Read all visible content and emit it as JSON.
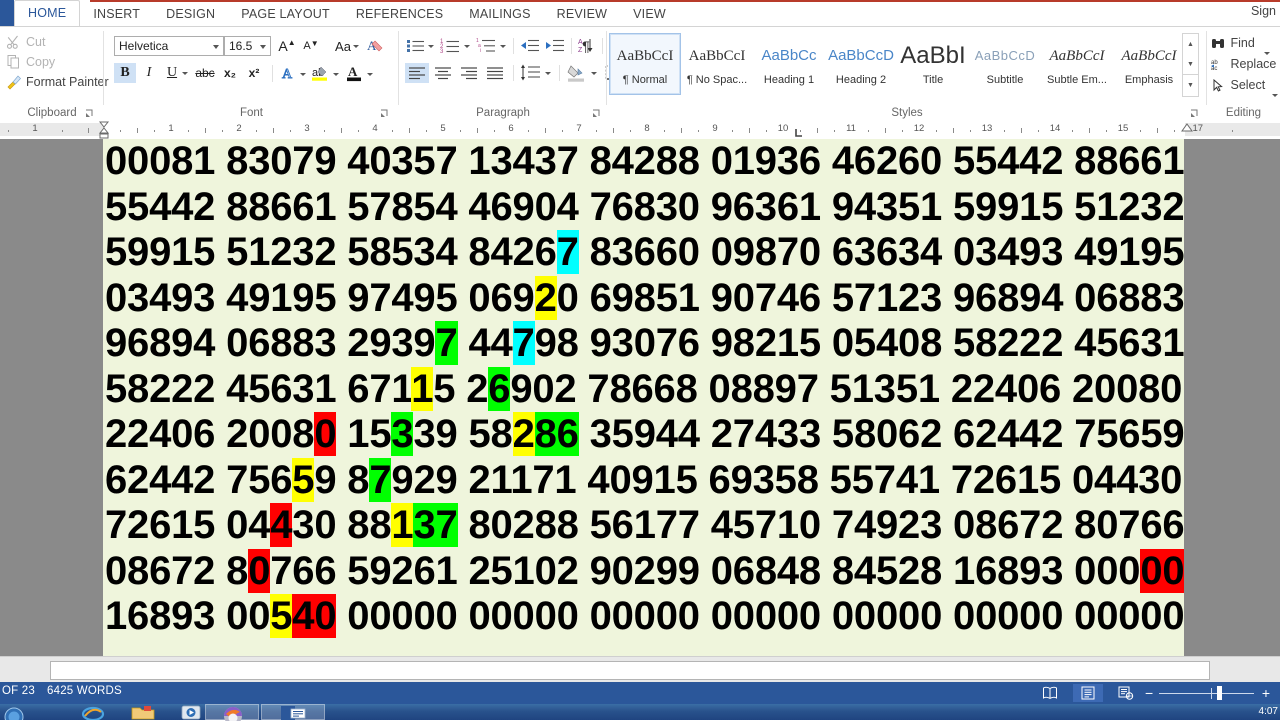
{
  "window": {
    "sign_in": "Sign",
    "accent": "#2b579a"
  },
  "ribbon": {
    "tabs": [
      {
        "label": "HOME",
        "active": true
      },
      {
        "label": "INSERT",
        "active": false
      },
      {
        "label": "DESIGN",
        "active": false
      },
      {
        "label": "PAGE LAYOUT",
        "active": false
      },
      {
        "label": "REFERENCES",
        "active": false
      },
      {
        "label": "MAILINGS",
        "active": false
      },
      {
        "label": "REVIEW",
        "active": false
      },
      {
        "label": "VIEW",
        "active": false
      }
    ],
    "clipboard": {
      "group_label": "Clipboard",
      "cut": "Cut",
      "copy": "Copy",
      "format_painter": "Format Painter"
    },
    "font": {
      "group_label": "Font",
      "font_name": "Helvetica",
      "font_size": "16.5",
      "bold": "B",
      "italic": "I",
      "underline": "U",
      "strikethrough": "abc",
      "subscript": "x₂",
      "superscript": "x²",
      "grow_font": "A",
      "shrink_font": "A",
      "change_case": "Aa",
      "clear_formatting": "clear-formatting-icon",
      "text_effects": "A",
      "highlight": "ab",
      "font_color": "A"
    },
    "paragraph": {
      "group_label": "Paragraph"
    },
    "styles": {
      "group_label": "Styles",
      "items": [
        {
          "preview": "AaBbCcI",
          "name": "¶ Normal",
          "selected": true,
          "style": "serif-normal"
        },
        {
          "preview": "AaBbCcI",
          "name": "¶ No Spac...",
          "selected": false,
          "style": "serif-normal"
        },
        {
          "preview": "AaBbCc",
          "name": "Heading 1",
          "selected": false,
          "style": "blue-heading"
        },
        {
          "preview": "AaBbCcD",
          "name": "Heading 2",
          "selected": false,
          "style": "blue-heading"
        },
        {
          "preview": "AaBbI",
          "name": "Title",
          "selected": false,
          "style": "title"
        },
        {
          "preview": "AaBbCcD",
          "name": "Subtitle",
          "selected": false,
          "style": "subtitle"
        },
        {
          "preview": "AaBbCcI",
          "name": "Subtle Em...",
          "selected": false,
          "style": "italic"
        },
        {
          "preview": "AaBbCcI",
          "name": "Emphasis",
          "selected": false,
          "style": "italic"
        }
      ]
    },
    "editing": {
      "group_label": "Editing",
      "find": "Find",
      "replace": "Replace",
      "select": "Select"
    }
  },
  "ruler": {
    "left_numbers": [
      "1"
    ],
    "numbers": [
      "1",
      "2",
      "3",
      "4",
      "5",
      "6",
      "7",
      "8",
      "9",
      "10",
      "11",
      "12",
      "13",
      "14",
      "15",
      "17"
    ]
  },
  "document": {
    "page_background": "#eff5dc",
    "font_family": "Helvetica",
    "highlight_colors": {
      "yellow": "#ffff00",
      "green": "#00ff00",
      "cyan": "#00ffff",
      "red": "#ff0000"
    },
    "lines": [
      {
        "text": "00081 83079 40357 13437 84288 01936 46260 55442 88661",
        "runs": [
          {
            "t": "00081 83079 40357 13437 84288 01936 46260 55442 88661",
            "h": null
          }
        ]
      },
      {
        "text": "55442 88661 57854 46904 76830 96361 94351 59915 51232",
        "runs": [
          {
            "t": "55442 88661 57854 46904 76830 96361 94351 59915 51232",
            "h": null
          }
        ]
      },
      {
        "text": "59915 51232 58534 84267 83660 09870 63634 03493 49195",
        "runs": [
          {
            "t": "59915 51232 58534 8426",
            "h": null
          },
          {
            "t": "7",
            "h": "cyan"
          },
          {
            "t": " 83660 09870 63634 03493 49195",
            "h": null
          }
        ]
      },
      {
        "text": "03493 49195 97495 06920 69851 90746 57123 96894 06883",
        "runs": [
          {
            "t": "03493 49195 97495 069",
            "h": null
          },
          {
            "t": "2",
            "h": "yellow"
          },
          {
            "t": "0 69851 90746 57123 96894 06883",
            "h": null
          }
        ]
      },
      {
        "text": "96894 06883 29397 44798 93076 98215 05408 58222 45631",
        "runs": [
          {
            "t": "96894 06883 2939",
            "h": null
          },
          {
            "t": "7",
            "h": "green"
          },
          {
            "t": " 44",
            "h": null
          },
          {
            "t": "7",
            "h": "cyan"
          },
          {
            "t": "98 93076 98215 05408 58222 45631",
            "h": null
          }
        ]
      },
      {
        "text": "58222 45631 67115 26902 78668 08897 51351 22406 20080",
        "runs": [
          {
            "t": "58222 45631 671",
            "h": null
          },
          {
            "t": "1",
            "h": "yellow"
          },
          {
            "t": "5 2",
            "h": null
          },
          {
            "t": "6",
            "h": "green"
          },
          {
            "t": "902 78668 08897 51351 22406 20080",
            "h": null
          }
        ]
      },
      {
        "text": "22406 20080 15339 58286 35944 27433 58062 62442 75659",
        "runs": [
          {
            "t": "22406 2008",
            "h": null
          },
          {
            "t": "0",
            "h": "red"
          },
          {
            "t": " 15",
            "h": null
          },
          {
            "t": "3",
            "h": "green"
          },
          {
            "t": "39 58",
            "h": null
          },
          {
            "t": "2",
            "h": "yellow"
          },
          {
            "t": "86",
            "h": "green"
          },
          {
            "t": " 35944 27433 58062 62442 75659",
            "h": null
          }
        ]
      },
      {
        "text": "62442 75659 87929 21171 40915 69358 55741 72615 04430",
        "runs": [
          {
            "t": "62442 756",
            "h": null
          },
          {
            "t": "5",
            "h": "yellow"
          },
          {
            "t": "9 8",
            "h": null
          },
          {
            "t": "7",
            "h": "green"
          },
          {
            "t": "929 21171 40915 69358 55741 72615 04430",
            "h": null
          }
        ]
      },
      {
        "text": "72615 04430 88137 80288 56177 45710 74923 08672 80766",
        "runs": [
          {
            "t": "72615 04",
            "h": null
          },
          {
            "t": "4",
            "h": "red"
          },
          {
            "t": "30 88",
            "h": null
          },
          {
            "t": "1",
            "h": "yellow"
          },
          {
            "t": "37",
            "h": "green"
          },
          {
            "t": " 80288 56177 45710 74923 08672 80766",
            "h": null
          }
        ]
      },
      {
        "text": "08672 80766 59261 25102 90299 06848 84528 16893 00000",
        "runs": [
          {
            "t": "08672 8",
            "h": null
          },
          {
            "t": "0",
            "h": "red"
          },
          {
            "t": "766 59261 25102 90299 06848 84528 16893 000",
            "h": null
          },
          {
            "t": "00",
            "h": "red"
          }
        ]
      },
      {
        "text": "16893 00540 00000 00000 00000 00000 00000 00000 00000",
        "runs": [
          {
            "t": "16893 00",
            "h": null
          },
          {
            "t": "5",
            "h": "yellow"
          },
          {
            "t": "40",
            "h": "red"
          },
          {
            "t": " 00000 00000 00000 00000 00000 00000 00000",
            "h": null
          }
        ]
      }
    ]
  },
  "status_bar": {
    "page_of": "OF 23",
    "word_count": "6425 WORDS",
    "views": [
      "read-mode-icon",
      "print-layout-icon",
      "web-layout-icon"
    ],
    "active_view_index": 1,
    "zoom_minus": "−",
    "zoom_plus": "+"
  },
  "taskbar": {
    "items": [
      "start-orb",
      "internet-explorer-icon",
      "file-explorer-icon",
      "media-player-icon",
      "firefox-icon",
      "word-icon"
    ],
    "clock": "4:07"
  }
}
